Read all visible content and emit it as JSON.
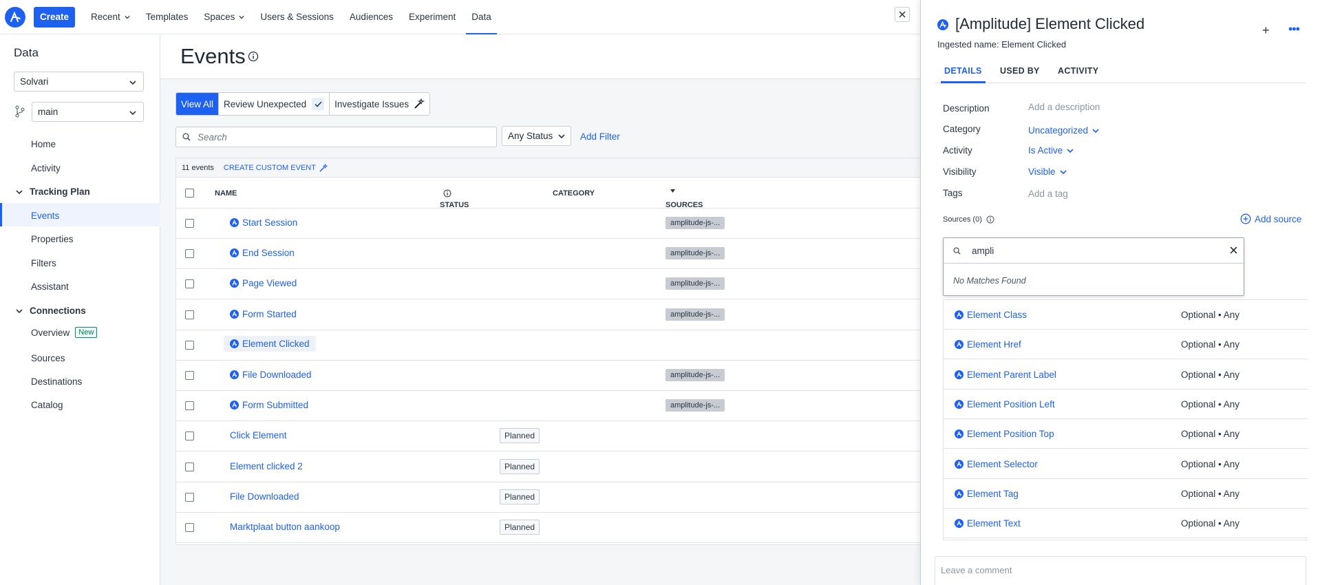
{
  "topbar": {
    "create_label": "Create",
    "nav": [
      {
        "label": "Recent",
        "dropdown": true
      },
      {
        "label": "Templates",
        "dropdown": false
      },
      {
        "label": "Spaces",
        "dropdown": true
      },
      {
        "label": "Users & Sessions",
        "dropdown": false
      },
      {
        "label": "Audiences",
        "dropdown": false
      },
      {
        "label": "Experiment",
        "dropdown": false
      },
      {
        "label": "Data",
        "dropdown": false,
        "active": true
      }
    ]
  },
  "sidebar": {
    "title": "Data",
    "project": "Solvari",
    "branch": "main",
    "home": "Home",
    "activity": "Activity",
    "tracking_plan": "Tracking Plan",
    "events": "Events",
    "properties": "Properties",
    "filters": "Filters",
    "assistant": "Assistant",
    "connections": "Connections",
    "overview": "Overview",
    "overview_badge": "New",
    "sources": "Sources",
    "destinations": "Destinations",
    "catalog": "Catalog"
  },
  "main": {
    "title": "Events",
    "tabs": {
      "view_all": "View All",
      "review": "Review Unexpected",
      "investigate": "Investigate Issues"
    },
    "search_placeholder": "Search",
    "status_filter": "Any Status",
    "add_filter": "Add Filter",
    "count": "11 events",
    "create_custom": "CREATE CUSTOM EVENT",
    "columns": {
      "name": "NAME",
      "status": "STATUS",
      "category": "CATEGORY",
      "sources": "SOURCES"
    },
    "rows": [
      {
        "name": "Start Session",
        "amplitude": true,
        "status": "",
        "source": "amplitude-js-..."
      },
      {
        "name": "End Session",
        "amplitude": true,
        "status": "",
        "source": "amplitude-js-..."
      },
      {
        "name": "Page Viewed",
        "amplitude": true,
        "status": "",
        "source": "amplitude-js-..."
      },
      {
        "name": "Form Started",
        "amplitude": true,
        "status": "",
        "source": "amplitude-js-..."
      },
      {
        "name": "Element Clicked",
        "amplitude": true,
        "status": "",
        "source": "",
        "selected": true
      },
      {
        "name": "File Downloaded",
        "amplitude": true,
        "status": "",
        "source": "amplitude-js-..."
      },
      {
        "name": "Form Submitted",
        "amplitude": true,
        "status": "",
        "source": "amplitude-js-..."
      },
      {
        "name": "Click Element",
        "amplitude": false,
        "status": "Planned",
        "source": ""
      },
      {
        "name": "Element clicked 2",
        "amplitude": false,
        "status": "Planned",
        "source": ""
      },
      {
        "name": "File Downloaded",
        "amplitude": false,
        "status": "Planned",
        "source": ""
      },
      {
        "name": "Marktplaat button aankoop",
        "amplitude": false,
        "status": "Planned",
        "source": ""
      }
    ]
  },
  "panel": {
    "title": "[Amplitude] Element Clicked",
    "ingested": "Ingested name: Element Clicked",
    "plus": "+",
    "more": "•••",
    "tabs": [
      "DETAILS",
      "USED BY",
      "ACTIVITY"
    ],
    "description_label": "Description",
    "description_value": "Add a description",
    "category_label": "Category",
    "category_value": "Uncategorized",
    "activity_label": "Activity",
    "activity_value": "Is Active",
    "visibility_label": "Visibility",
    "visibility_value": "Visible",
    "tags_label": "Tags",
    "tags_value": "Add a tag",
    "sources_label": "Sources (0)",
    "add_source": "Add source",
    "source_search_value": "ampli",
    "no_matches": "No Matches Found",
    "properties": [
      {
        "name": "Element Class",
        "req": "Optional • Any"
      },
      {
        "name": "Element Href",
        "req": "Optional • Any"
      },
      {
        "name": "Element Parent Label",
        "req": "Optional • Any"
      },
      {
        "name": "Element Position Left",
        "req": "Optional • Any"
      },
      {
        "name": "Element Position Top",
        "req": "Optional • Any"
      },
      {
        "name": "Element Selector",
        "req": "Optional • Any"
      },
      {
        "name": "Element Tag",
        "req": "Optional • Any"
      },
      {
        "name": "Element Text",
        "req": "Optional • Any"
      }
    ],
    "comment_placeholder": "Leave a comment"
  },
  "colors": {
    "accent": "#1e61f0",
    "badge_green": "#0b7a5e"
  }
}
